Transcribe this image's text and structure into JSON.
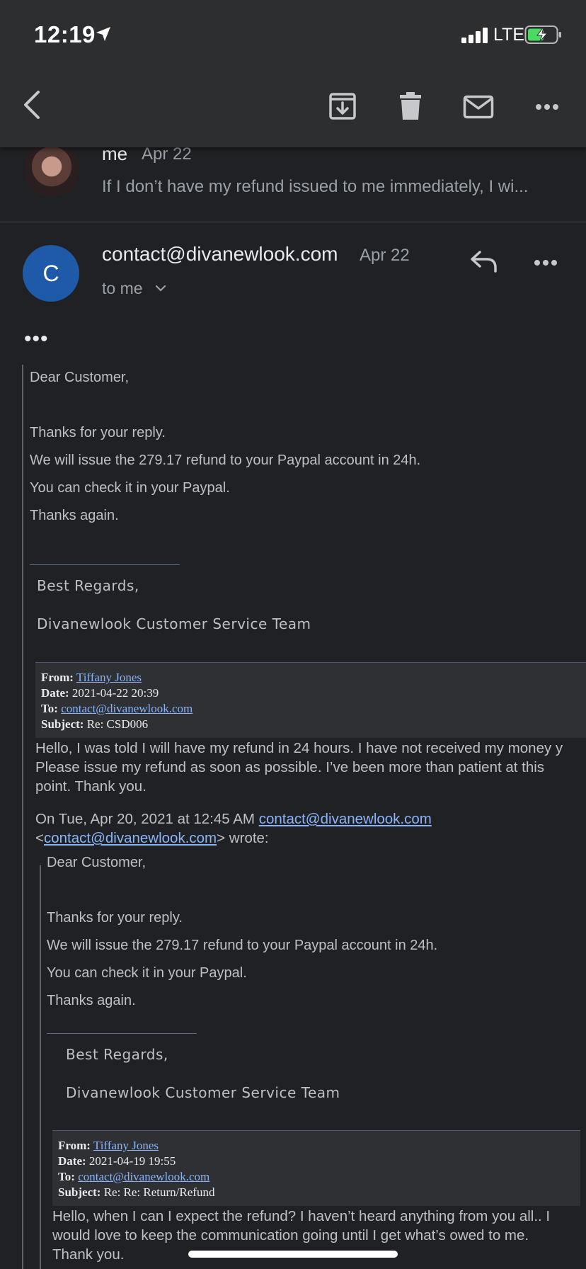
{
  "status_bar": {
    "time": "12:19",
    "network": "LTE"
  },
  "toolbar": {
    "back_icon": "chevron-left-icon",
    "archive_icon": "archive-icon",
    "delete_icon": "trash-icon",
    "mark_icon": "mail-icon",
    "more_icon": "more-horizontal-icon"
  },
  "previous_message": {
    "sender": "me",
    "date": "Apr 22",
    "snippet": "If I don’t have my refund issued to me immediately, I wi..."
  },
  "message": {
    "avatar_letter": "C",
    "avatar_color": "#1e5aa8",
    "sender": "contact@divanewlook.com",
    "date": "Apr 22",
    "recipient": "to me",
    "trimmed_indicator": "•••",
    "body": {
      "greeting": "Dear Customer,",
      "line1": "Thanks for your reply.",
      "line2": "We will issue the 279.17 refund to your Paypal account in 24h.",
      "line3": "You can check it in your Paypal.",
      "line4": "Thanks again.",
      "regards": "Best Regards,",
      "team": "Divanewlook Customer Service Team"
    },
    "quoted_header": {
      "from_label": "From:",
      "from": "Tiffany Jones",
      "date_label": "Date:",
      "date": "2021-04-22 20:39",
      "to_label": "To:",
      "to": "contact@divanewlook.com",
      "subject_label": "Subject:",
      "subject": "Re: CSD006"
    },
    "quoted_reply": {
      "line1": "Hello, I was told I will have my refund in 24 hours. I have not received my money y",
      "line2": "Please issue my refund as soon as possible. I’ve been more than patient at this",
      "line3": "point. Thank you."
    },
    "attribution": {
      "prefix": "On Tue, Apr 20, 2021 at 12:45 AM",
      "email": "contact@divanewlook.com",
      "open": "<",
      "email2": "contact@divanewlook.com",
      "close": "> wrote:"
    },
    "nested_body": {
      "greeting": "Dear Customer,",
      "line1": "Thanks for your reply.",
      "line2": "We will issue the 279.17 refund to your Paypal account in 24h.",
      "line3": "You can check it in your Paypal.",
      "line4": "Thanks again.",
      "regards": "Best Regards,",
      "team": "Divanewlook Customer Service Team"
    },
    "nested_header": {
      "from_label": "From:",
      "from": "Tiffany Jones",
      "date_label": "Date:",
      "date": "2021-04-19 19:55",
      "to_label": "To:",
      "to": "contact@divanewlook.com",
      "subject_label": "Subject:",
      "subject": "Re: Re: Return/Refund"
    },
    "nested_reply": {
      "line1": "Hello, when I can I expect the refund? I haven’t heard anything from you all.. I",
      "line2": "would love to keep the communication going until I get what’s owed to me.",
      "line3": "Thank you."
    }
  }
}
